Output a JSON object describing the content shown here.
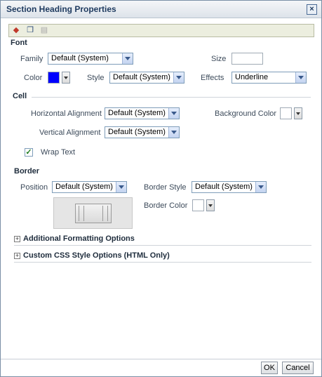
{
  "dialog": {
    "title": "Section Heading Properties",
    "close_icon": "close-icon"
  },
  "toolbar": {
    "icons": [
      "eraser-icon",
      "copy-icon",
      "paste-icon"
    ]
  },
  "font": {
    "heading": "Font",
    "family_label": "Family",
    "family_value": "Default (System)",
    "size_label": "Size",
    "size_value": "",
    "color_label": "Color",
    "color_value": "#0000ff",
    "style_label": "Style",
    "style_value": "Default (System)",
    "effects_label": "Effects",
    "effects_value": "Underline"
  },
  "cell": {
    "heading": "Cell",
    "halign_label": "Horizontal Alignment",
    "halign_value": "Default (System)",
    "bgcolor_label": "Background Color",
    "bgcolor_value": "#ffffff",
    "valign_label": "Vertical Alignment",
    "valign_value": "Default (System)",
    "wrap_label": "Wrap Text",
    "wrap_checked": true
  },
  "border": {
    "heading": "Border",
    "position_label": "Position",
    "position_value": "Default (System)",
    "style_label": "Border Style",
    "style_value": "Default (System)",
    "color_label": "Border Color",
    "color_value": "#ffffff"
  },
  "sections": {
    "additional": "Additional Formatting Options",
    "custom_css": "Custom CSS Style Options (HTML Only)"
  },
  "footer": {
    "ok_label": "OK",
    "cancel_label": "Cancel"
  }
}
